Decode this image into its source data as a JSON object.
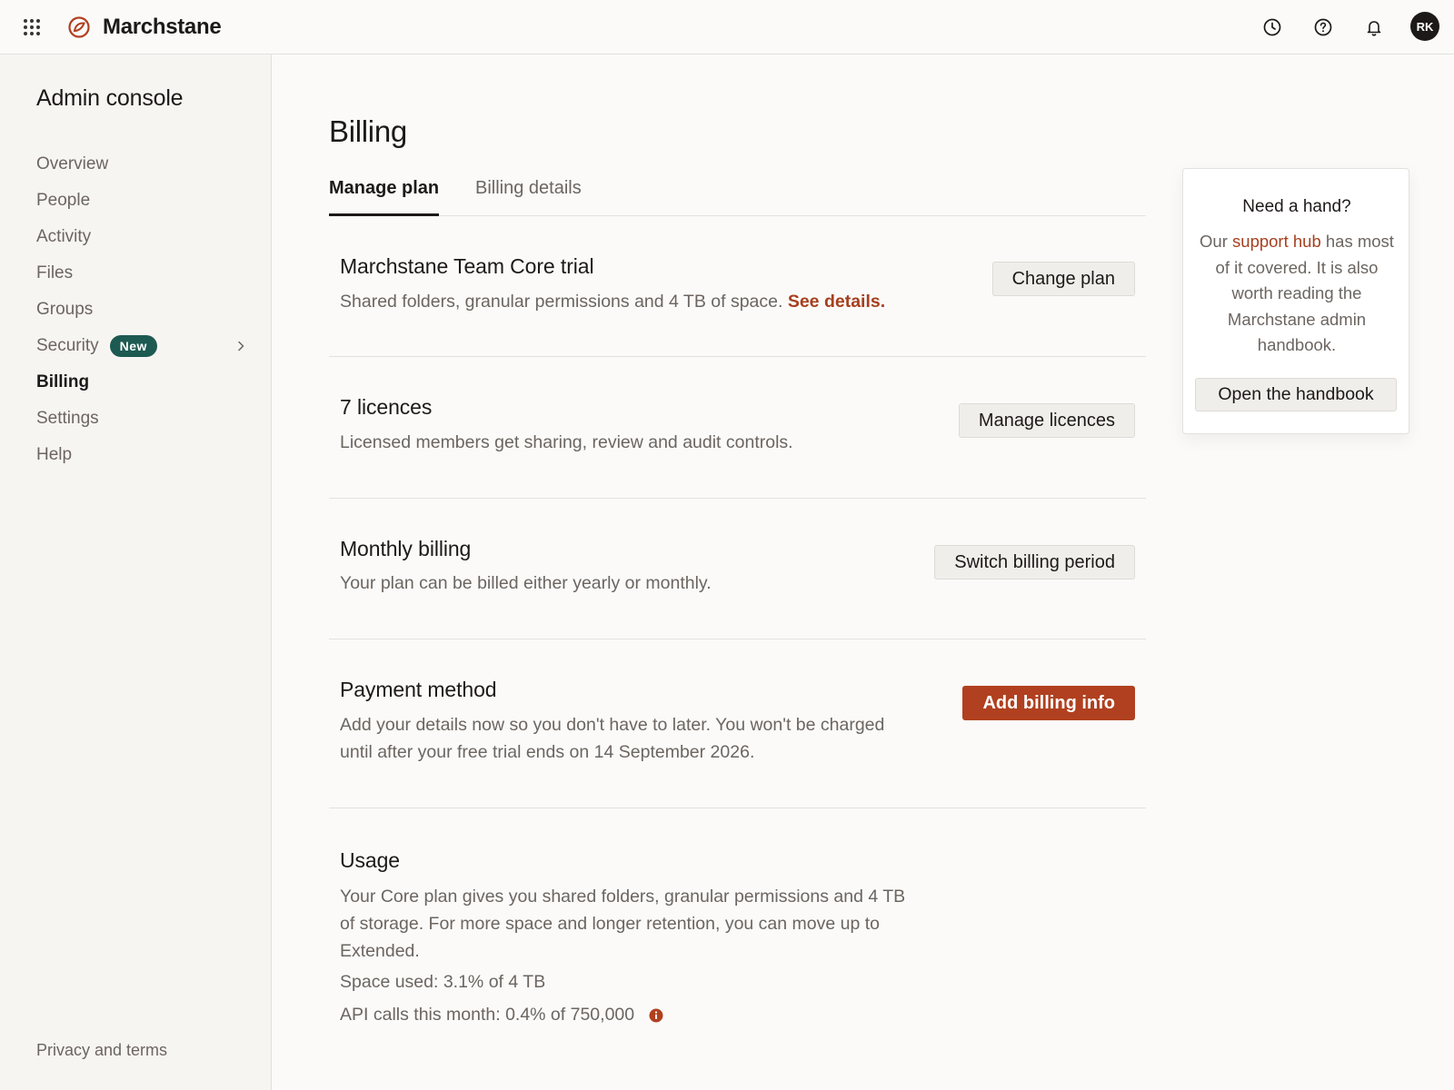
{
  "app": {
    "brand": "Marchstane",
    "avatar_initials": "RK",
    "accent_color": "#b0401f",
    "badge_color": "#1d5a52",
    "icons": [
      "apps-grid-icon",
      "marchstane-logo-icon",
      "clock-icon",
      "help-icon",
      "bell-icon"
    ]
  },
  "sidebar": {
    "title": "Admin console",
    "items": [
      {
        "label": "Overview"
      },
      {
        "label": "People"
      },
      {
        "label": "Activity"
      },
      {
        "label": "Files"
      },
      {
        "label": "Groups"
      },
      {
        "label": "Security",
        "badge": "New"
      },
      {
        "label": "Billing",
        "active": true
      },
      {
        "label": "Settings"
      },
      {
        "label": "Help"
      }
    ],
    "footer_link": "Privacy and terms"
  },
  "main": {
    "title": "Billing",
    "tabs": [
      {
        "label": "Manage plan",
        "active": true
      },
      {
        "label": "Billing details"
      }
    ],
    "sections": {
      "plan": {
        "title": "Marchstane Team Core trial",
        "desc": "Shared folders, granular permissions and 4 TB of space.",
        "link": "See details.",
        "button": "Change plan"
      },
      "licences": {
        "title": "7 licences",
        "desc": "Licensed members get sharing, review and audit controls.",
        "button": "Manage licences"
      },
      "billing": {
        "title": "Monthly billing",
        "desc": "Your plan can be billed either yearly or monthly.",
        "button": "Switch billing period"
      },
      "payment": {
        "title": "Payment method",
        "desc_line1": "Add your details now so you don't have to later. You won't be charged",
        "desc_line2": "until after your free trial ends on 14 September 2026.",
        "button": "Add billing info"
      },
      "usage": {
        "title": "Usage",
        "desc_line1": "Your Core plan gives you shared folders, granular permissions and 4 TB",
        "desc_line2": "of storage. For more space and longer retention, you can move up to",
        "desc_line3": "Extended.",
        "space_used": "Space used: 3.1% of 4 TB",
        "api_calls": "API calls this month: 0.4% of 750,000"
      }
    }
  },
  "help_card": {
    "title": "Need a hand?",
    "text_pre": "Our ",
    "text_link": "support hub",
    "text_post": " has most of it covered. It is also worth reading the Marchstane admin handbook.",
    "button": "Open the handbook"
  }
}
